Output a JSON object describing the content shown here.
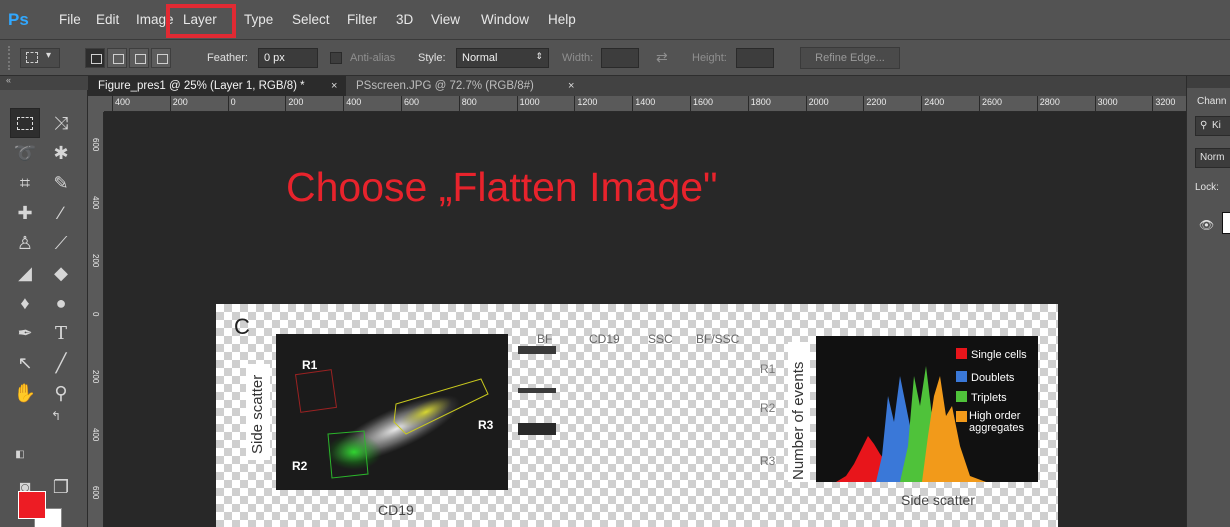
{
  "app": {
    "logo": "Ps"
  },
  "menu": {
    "items": [
      "File",
      "Edit",
      "Image",
      "Layer",
      "Type",
      "Select",
      "Filter",
      "3D",
      "View",
      "Window",
      "Help"
    ],
    "highlighted": "Layer",
    "highlight_color": "#e12a33"
  },
  "options": {
    "feather_label": "Feather:",
    "feather_value": "0 px",
    "antialias_label": "Anti-alias",
    "style_label": "Style:",
    "style_value": "Normal",
    "width_label": "Width:",
    "height_label": "Height:",
    "refine_edge_label": "Refine Edge..."
  },
  "tabs": [
    {
      "title": "Figure_pres1 @ 25% (Layer 1, RGB/8) *",
      "active": true
    },
    {
      "title": "PSscreen.JPG @ 72.7% (RGB/8#)",
      "active": false
    }
  ],
  "ruler": {
    "top_labels": [
      "400",
      "200",
      "0",
      "200",
      "400",
      "600",
      "800",
      "1000",
      "1200",
      "1400",
      "1600",
      "1800",
      "2000",
      "2200",
      "2400",
      "2600",
      "2800",
      "3000",
      "3200"
    ],
    "left_labels": [
      "600",
      "400",
      "200",
      "0",
      "200",
      "400",
      "600"
    ]
  },
  "canvas": {
    "instruction": "Choose „Flatten Image\"",
    "instruction_color": "#e8232c",
    "figure": {
      "panel_letter": "C",
      "scatter": {
        "ylabel": "Side scatter",
        "xlabel": "CD19",
        "regions": [
          "R1",
          "R2",
          "R3"
        ]
      },
      "image_columns": [
        "BF",
        "CD19",
        "SSC",
        "BF/SSC"
      ],
      "image_rows": [
        "R1",
        "R2",
        "R3"
      ],
      "histogram": {
        "ylabel": "Number of events",
        "xlabel": "Side scatter",
        "legend": [
          {
            "label": "Single cells",
            "color": "#e8151b"
          },
          {
            "label": "Doublets",
            "color": "#3a78d8"
          },
          {
            "label": "Triplets",
            "color": "#4fc23a"
          },
          {
            "label": "High order aggregates",
            "color": "#f29a1a"
          }
        ]
      }
    }
  },
  "colors": {
    "foreground": "#ed1c24",
    "background": "#ffffff"
  },
  "right_panel": {
    "title": "Chann",
    "kind_label": "Ki",
    "blend_label": "Norm",
    "lock_label": "Lock:"
  }
}
